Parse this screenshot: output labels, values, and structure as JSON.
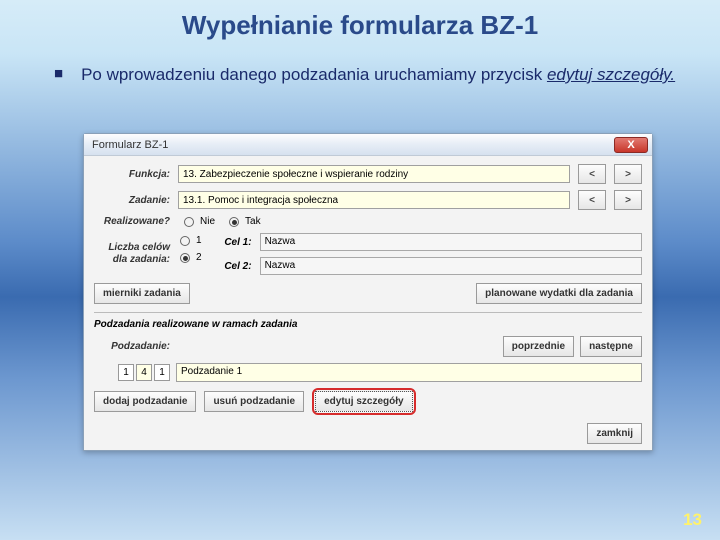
{
  "slide": {
    "title": "Wypełnianie formularza BZ-1",
    "bullet_prefix": "Po wprowadzeniu danego podzadania uruchamiamy przycisk ",
    "bullet_em": "edytuj szczegóły.",
    "page_number": "13"
  },
  "window": {
    "title": "Formularz BZ-1",
    "close": "X",
    "labels": {
      "funkcja": "Funkcja:",
      "zadanie": "Zadanie:",
      "realizowane": "Realizowane?",
      "liczba_celow": "Liczba celów dla zadania:",
      "cel1": "Cel 1:",
      "cel2": "Cel 2:",
      "podzadanie": "Podzadanie:",
      "section": "Podzadania realizowane w ramach zadania"
    },
    "values": {
      "funkcja": "13. Zabezpieczenie społeczne i wspieranie rodziny",
      "zadanie": "13.1. Pomoc i integracja społeczna",
      "cel1": "Nazwa",
      "cel2": "Nazwa",
      "podzadanie": "Podzadanie 1"
    },
    "radios": {
      "nie": "Nie",
      "tak": "Tak",
      "one": "1",
      "two": "2"
    },
    "nav": {
      "prev": "<",
      "next": ">"
    },
    "counter": {
      "left": "1",
      "mid": "4",
      "right": "1"
    },
    "buttons": {
      "mierniki": "mierniki zadania",
      "wydatki": "planowane wydatki dla zadania",
      "poprzednie": "poprzednie",
      "nastepne": "następne",
      "dodaj": "dodaj podzadanie",
      "usun": "usuń podzadanie",
      "edytuj": "edytuj szczegóły",
      "zamknij": "zamknij"
    }
  }
}
